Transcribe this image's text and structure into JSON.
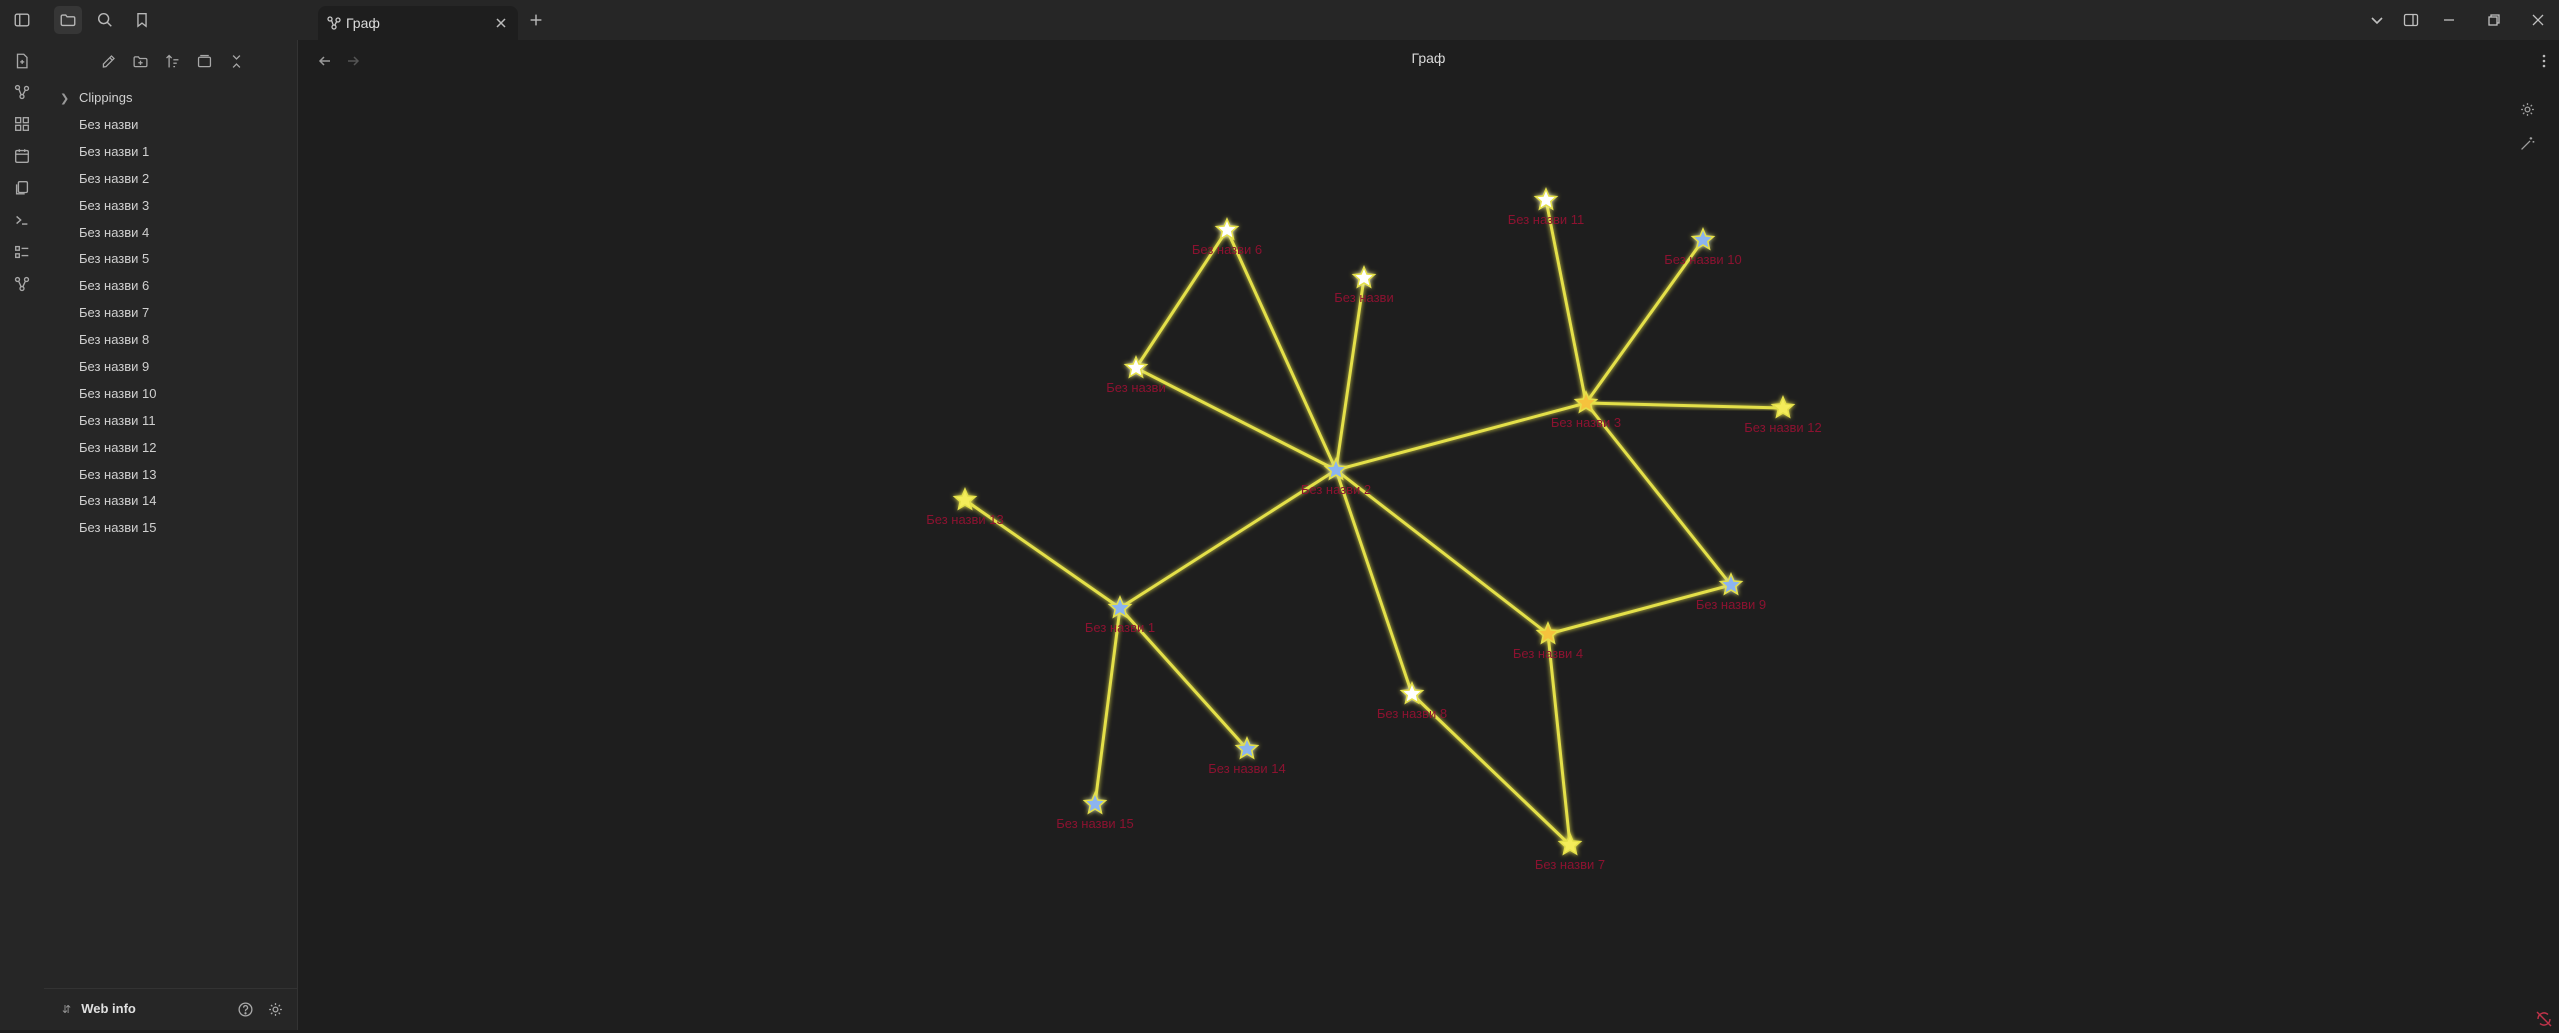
{
  "tab": {
    "label": "Граф"
  },
  "view": {
    "title": "Граф"
  },
  "sidebar": {
    "folder": "Clippings",
    "files": [
      "Без назви",
      "Без назви 1",
      "Без назви 2",
      "Без назви 3",
      "Без назви 4",
      "Без назви 5",
      "Без назви 6",
      "Без назви 7",
      "Без назви 8",
      "Без назви 9",
      "Без назви 10",
      "Без назви 11",
      "Без назви 12",
      "Без назви 13",
      "Без назви 14",
      "Без назви 15"
    ],
    "vault": "Web info"
  },
  "colors": {
    "edge": "#e4e04a",
    "label": "#8c1230",
    "node_white": "#ffffff",
    "node_blue": "#8cb4f0",
    "node_yellow": "#f3ec5a",
    "node_orange": "#f5c23c"
  },
  "graph": {
    "nodes": [
      {
        "id": "center",
        "label": "Без назви 2",
        "color": "blue"
      },
      {
        "id": "n6",
        "label": "Без назви 6",
        "color": "white"
      },
      {
        "id": "nA",
        "label": "Без назви",
        "color": "white"
      },
      {
        "id": "nB",
        "label": "Без назви",
        "color": "white"
      },
      {
        "id": "n11",
        "label": "Без назви 11",
        "color": "white"
      },
      {
        "id": "n10",
        "label": "Без назви 10",
        "color": "blue"
      },
      {
        "id": "n3",
        "label": "Без назви 3",
        "color": "orange"
      },
      {
        "id": "n12",
        "label": "Без назви 12",
        "color": "yellow"
      },
      {
        "id": "n13",
        "label": "Без назви 13",
        "color": "yellow"
      },
      {
        "id": "n1",
        "label": "Без назви 1",
        "color": "blue"
      },
      {
        "id": "n9",
        "label": "Без назви 9",
        "color": "blue"
      },
      {
        "id": "n4",
        "label": "Без назви 4",
        "color": "orange"
      },
      {
        "id": "n8",
        "label": "Без назви 8",
        "color": "white"
      },
      {
        "id": "n14",
        "label": "Без назви 14",
        "color": "blue"
      },
      {
        "id": "n15",
        "label": "Без назви 15",
        "color": "blue"
      },
      {
        "id": "n7",
        "label": "Без назви 7",
        "color": "yellow"
      }
    ],
    "edges": [
      [
        "nB",
        "n6"
      ],
      [
        "nB",
        "center"
      ],
      [
        "n6",
        "center"
      ],
      [
        "nA",
        "center"
      ],
      [
        "center",
        "n3"
      ],
      [
        "n3",
        "n11"
      ],
      [
        "n3",
        "n10"
      ],
      [
        "n3",
        "n12"
      ],
      [
        "n3",
        "n9"
      ],
      [
        "center",
        "n1"
      ],
      [
        "center",
        "n8"
      ],
      [
        "center",
        "n4"
      ],
      [
        "n4",
        "n9"
      ],
      [
        "n4",
        "n7"
      ],
      [
        "n8",
        "n7"
      ],
      [
        "n1",
        "n13"
      ],
      [
        "n1",
        "n14"
      ],
      [
        "n1",
        "n15"
      ]
    ]
  }
}
